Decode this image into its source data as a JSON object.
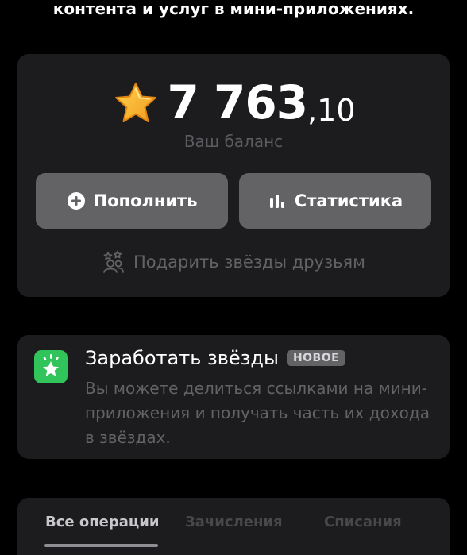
{
  "intro": {
    "tail_text": "контента и услуг в мини-приложениях."
  },
  "balance": {
    "integer": "7 763",
    "fraction": ",10",
    "caption": "Ваш баланс",
    "currency_icon": "star-icon",
    "star_color": "#f5a623"
  },
  "actions": {
    "topup_label": "Пополнить",
    "stats_label": "Статистика",
    "gift_label": "Подарить звёзды друзьям"
  },
  "earn": {
    "title": "Заработать звёзды",
    "badge": "НОВОЕ",
    "description": "Вы можете делиться ссылками на мини-приложения и получать часть их дохода в звёздах.",
    "icon_color": "#30c45a"
  },
  "tabs": {
    "items": [
      {
        "label": "Все операции",
        "active": true
      },
      {
        "label": "Зачисления",
        "active": false
      },
      {
        "label": "Списания",
        "active": false
      }
    ]
  }
}
